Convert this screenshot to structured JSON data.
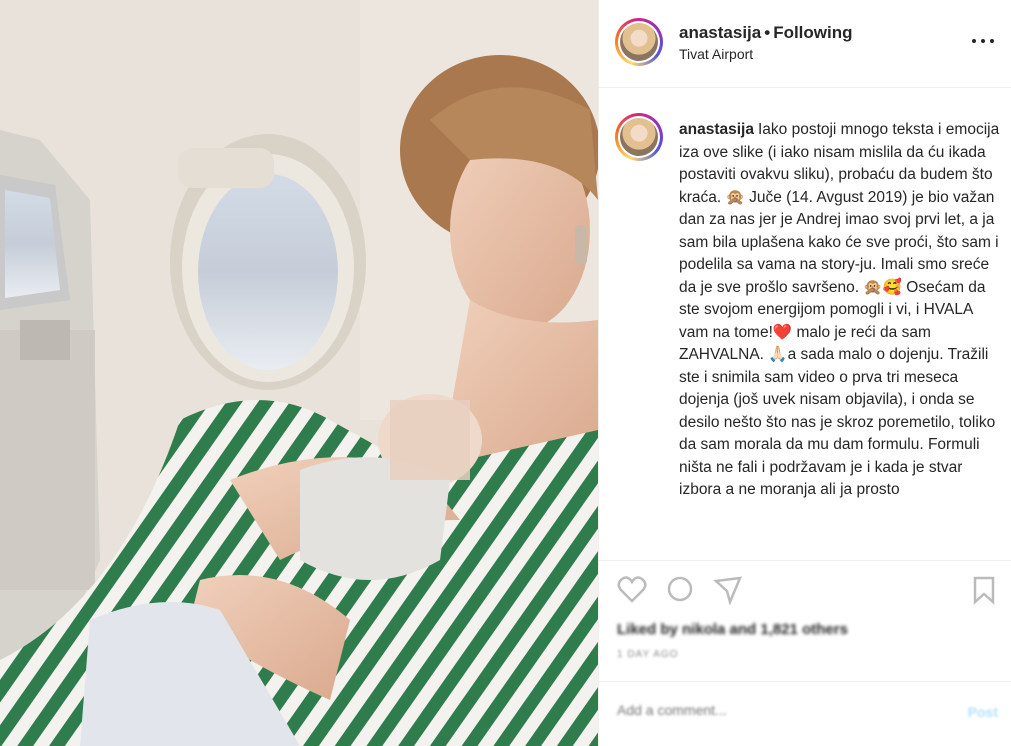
{
  "post": {
    "username": "anastasija",
    "separator": "•",
    "follow_status": "Following",
    "location": "Tivat Airport"
  },
  "caption": {
    "username": "anastasija",
    "text": "Iako postoji mnogo teksta i emocija iza ove slike (i iako nisam mislila da ću ikada postaviti ovakvu sliku), probaću da budem što kraća. 🙊 Juče (14. Avgust 2019) je bio važan dan za nas jer je Andrej imao svoj prvi let, a ja sam bila uplašena kako će sve proći, što sam i podelila sa vama na story-ju. Imali smo sreće da je sve prošlo savršeno. 🙊🥰 Osećam da ste svojom energijom pomogli i vi, i HVALA vam na tome!❤️ malo je reći da sam ZAHVALNA. 🙏🏻a sada malo o dojenju. Tražili ste i snimila sam video o prva tri meseca dojenja (još uvek nisam objavila), i onda se desilo nešto što nas je skroz poremetilo, toliko da sam morala da mu dam formulu. Formuli ništa ne fali i podržavam je i kada je stvar izbora a ne moranja ali ja prosto"
  },
  "actions": {
    "icons": [
      "heart-icon",
      "comment-icon",
      "share-icon",
      "bookmark-icon"
    ],
    "likes_text": "Liked by nikola and 1,821 others",
    "time_ago": "1 DAY AGO"
  },
  "comment": {
    "placeholder": "Add a comment...",
    "post_label": "Post"
  },
  "colors": {
    "text": "#262626",
    "muted": "#8e8e8e",
    "border": "#efefef",
    "stripe_green": "#2f7d4c",
    "post_disabled": "#b2dffc"
  }
}
